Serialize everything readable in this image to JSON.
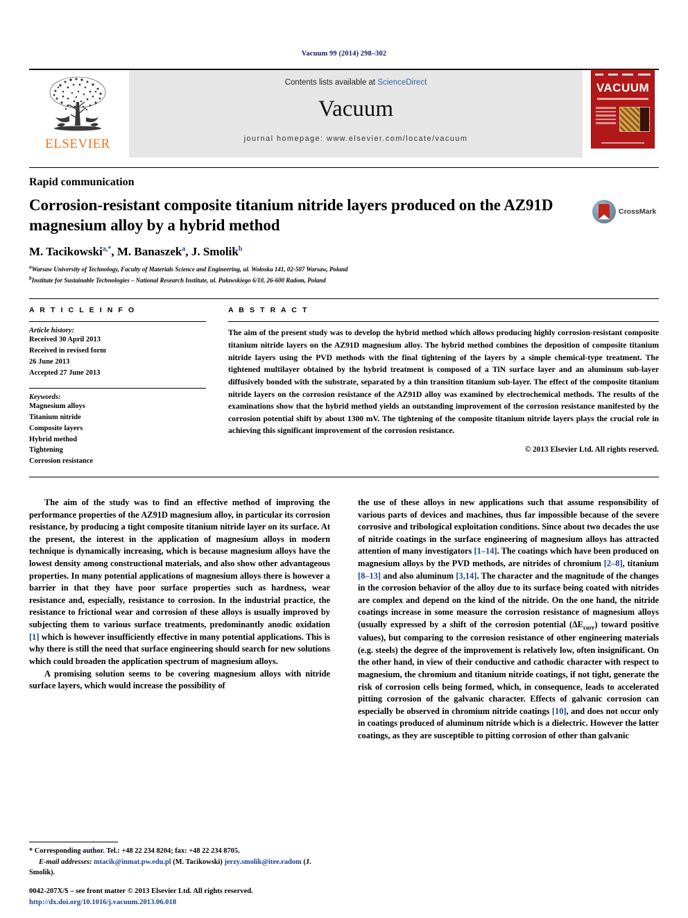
{
  "running_head": "Vacuum 99 (2014) 298–302",
  "masthead": {
    "publisher": "ELSEVIER",
    "contents_prefix": "Contents lists available at ",
    "contents_link": "ScienceDirect",
    "journal_title": "Vacuum",
    "homepage": "journal homepage: www.elsevier.com/locate/vacuum",
    "cover_word": "VACUUM",
    "brand_color": "#E87722",
    "cover_color": "#b11818",
    "link_color": "#2b5faa"
  },
  "article": {
    "section_label": "Rapid communication",
    "title": "Corrosion-resistant composite titanium nitride layers produced on the AZ91D magnesium alloy by a hybrid method",
    "crossmark_label": "CrossMark",
    "authors_html": "M. Tacikowski<sup>a,</sup><sup>*</sup>, M. Banaszek<sup>a</sup>, J. Smolik<sup>b</sup>",
    "affiliation_a": "Warsaw University of Technology, Faculty of Materials Science and Engineering, ul. Wołoska 141, 02-507 Warsaw, Poland",
    "affiliation_b": "Institute for Sustainable Technologies – National Research Institute, ul. Puławskiego 6/10, 26-600 Radom, Poland"
  },
  "article_info": {
    "heading": "A R T I C L E  I N F O",
    "history_label": "Article history:",
    "history": [
      "Received 30 April 2013",
      "Received in revised form",
      "26 June 2013",
      "Accepted 27 June 2013"
    ],
    "keywords_label": "Keywords:",
    "keywords": [
      "Magnesium alloys",
      "Titanium nitride",
      "Composite layers",
      "Hybrid method",
      "Tightening",
      "Corrosion resistance"
    ]
  },
  "abstract": {
    "heading": "A B S T R A C T",
    "text": "The aim of the present study was to develop the hybrid method which allows producing highly corrosion-resistant composite titanium nitride layers on the AZ91D magnesium alloy. The hybrid method combines the deposition of composite titanium nitride layers using the PVD methods with the final tightening of the layers by a simple chemical-type treatment. The tightened multilayer obtained by the hybrid treatment is composed of a TiN surface layer and an aluminum sub-layer diffusively bonded with the substrate, separated by a thin transition titanium sub-layer. The effect of the composite titanium nitride layers on the corrosion resistance of the AZ91D alloy was examined by electrochemical methods. The results of the examinations show that the hybrid method yields an outstanding improvement of the corrosion resistance manifested by the corrosion potential shift by about 1300 mV. The tightening of the composite titanium nitride layers plays the crucial role in achieving this significant improvement of the corrosion resistance.",
    "copyright": "© 2013 Elsevier Ltd. All rights reserved."
  },
  "body": {
    "left_p1": "The aim of the study was to find an effective method of improving the performance properties of the AZ91D magnesium alloy, in particular its corrosion resistance, by producing a tight composite titanium nitride layer on its surface. At the present, the interest in the application of magnesium alloys in modern technique is dynamically increasing, which is because magnesium alloys have the lowest density among constructional materials, and also show other advantageous properties. In many potential applications of magnesium alloys there is however a barrier in that they have poor surface properties such as hardness, wear resistance and, especially, resistance to corrosion. In the industrial practice, the resistance to frictional wear and corrosion of these alloys is usually improved by subjecting them to various surface treatments, predominantly anodic oxidation ",
    "left_p1_ref": "[1]",
    "left_p1_tail": " which is however insufficiently effective in many potential applications. This is why there is still the need that surface engineering should search for new solutions which could broaden the application spectrum of magnesium alloys.",
    "left_p2": "A promising solution seems to be covering magnesium alloys with nitride surface layers, which would increase the possibility of",
    "right_p1_a": "the use of these alloys in new applications such that assume responsibility of various parts of devices and machines, thus far impossible because of the severe corrosive and tribological exploitation conditions. Since about two decades the use of nitride coatings in the surface engineering of magnesium alloys has attracted attention of many investigators ",
    "right_ref1": "[1–14]",
    "right_p1_b": ". The coatings which have been produced on magnesium alloys by the PVD methods, are nitrides of chromium ",
    "right_ref2": "[2–8]",
    "right_p1_c": ", titanium ",
    "right_ref3": "[8–13]",
    "right_p1_d": " and also aluminum ",
    "right_ref4": "[3,14]",
    "right_p1_e": ". The character and the magnitude of the changes in the corrosion behavior of the alloy due to its surface being coated with nitrides are complex and depend on the kind of the nitride. On the one hand, the nitride coatings increase in some measure the corrosion resistance of magnesium alloys (usually expressed by a shift of the corrosion potential (ΔE",
    "right_sub": "corr",
    "right_p1_f": ") toward positive values), but comparing to the corrosion resistance of other engineering materials (e.g. steels) the degree of the improvement is relatively low, often insignificant. On the other hand, in view of their conductive and cathodic character with respect to magnesium, the chromium and titanium nitride coatings, if not tight, generate the risk of corrosion cells being formed, which, in consequence, leads to accelerated pitting corrosion of the galvanic character. Effects of galvanic corrosion can especially be observed in chromium nitride coatings ",
    "right_ref5": "[10]",
    "right_p1_g": ", and does not occur only in coatings produced of aluminum nitride which is a dielectric. However the latter coatings, as they are susceptible to pitting corrosion of other than galvanic"
  },
  "footnotes": {
    "corresponding": "* Corresponding author. Tel.: +48 22 234 8204; fax: +48 22 234 8705.",
    "email_label": "E-mail addresses:",
    "email1": "mtacik@inmat.pw.edu.pl",
    "email1_name": "(M. Tacikowski)",
    "email2": "jerzy.smolik@itee.radom",
    "email2_name": "(J. Smolik).",
    "imprint": "0042-207X/$ – see front matter © 2013 Elsevier Ltd. All rights reserved.",
    "doi": "http://dx.doi.org/10.1016/j.vacuum.2013.06.018"
  }
}
